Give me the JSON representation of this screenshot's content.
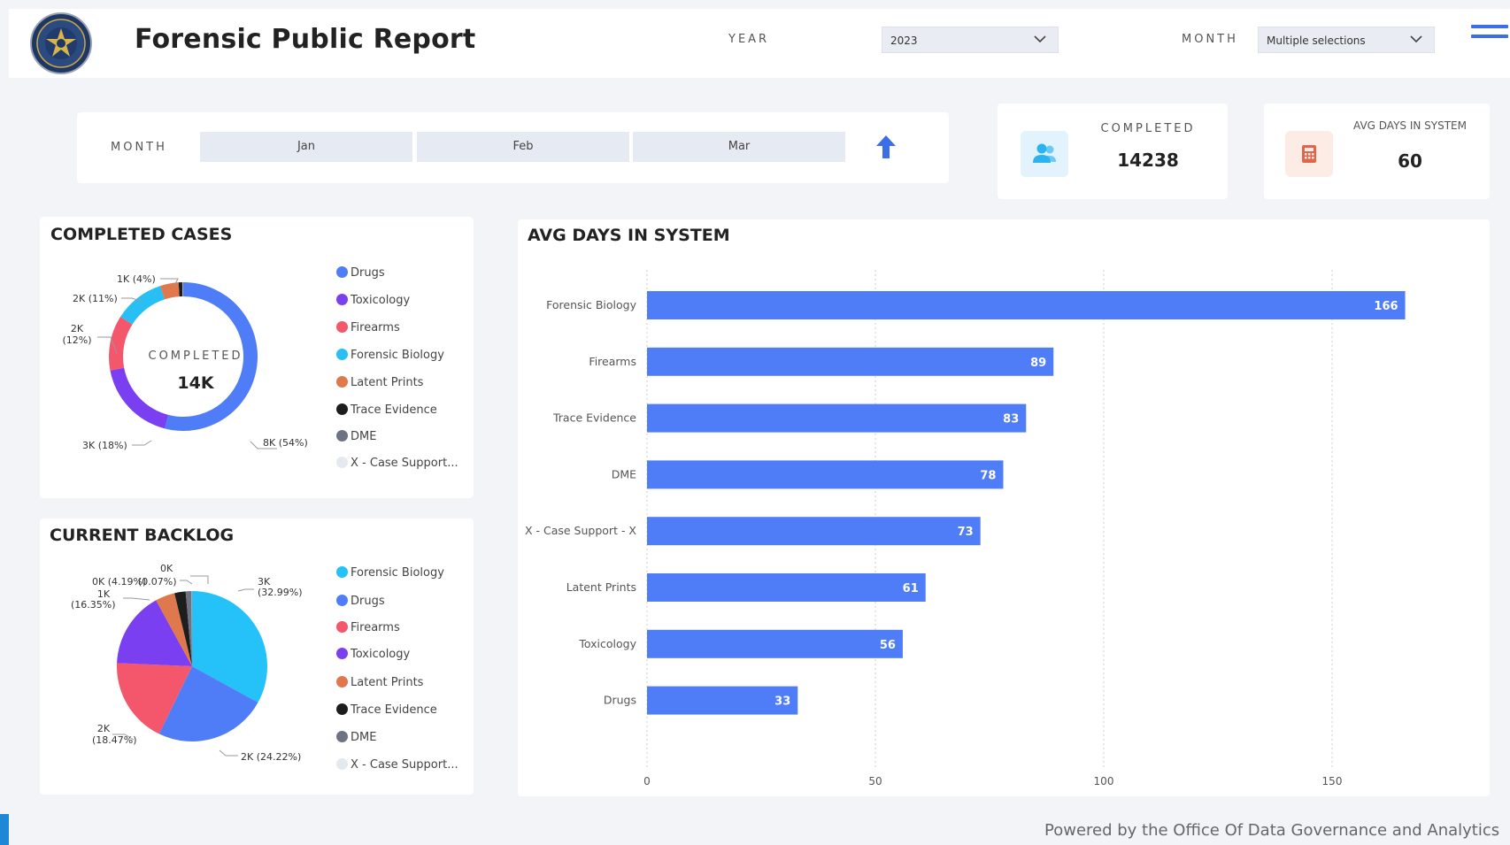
{
  "header": {
    "title": "Forensic Public Report",
    "year_label": "YEAR",
    "year_value": "2023",
    "month_label": "MONTH",
    "month_value": "Multiple selections"
  },
  "month_slicer": {
    "label": "MONTH",
    "months": [
      "Jan",
      "Feb",
      "Mar"
    ]
  },
  "kpis": {
    "completed": {
      "label": "COMPLETED",
      "value": "14238"
    },
    "avg_days": {
      "label": "AVG DAYS IN SYSTEM",
      "value": "60"
    }
  },
  "completed_cases": {
    "title": "COMPLETED CASES",
    "center_label": "COMPLETED",
    "center_value": "14K",
    "legend": [
      "Drugs",
      "Toxicology",
      "Firearms",
      "Forensic Biology",
      "Latent Prints",
      "Trace Evidence",
      "DME",
      "X - Case Support..."
    ],
    "labels": [
      "8K (54%)",
      "3K (18%)",
      "2K",
      "(12%)",
      "2K (11%)",
      "1K (4%)"
    ]
  },
  "current_backlog": {
    "title": "CURRENT BACKLOG",
    "legend": [
      "Forensic Biology",
      "Drugs",
      "Firearms",
      "Toxicology",
      "Latent Prints",
      "Trace Evidence",
      "DME",
      "X - Case Support..."
    ],
    "labels": [
      "3K",
      "(32.99%)",
      "2K (24.22%)",
      "2K",
      "(18.47%)",
      "1K",
      "(16.35%)",
      "0K (4.19%)",
      "(0.07%)",
      "0K"
    ]
  },
  "avg_days_chart": {
    "title": "AVG DAYS IN SYSTEM"
  },
  "chart_data": [
    {
      "type": "pie",
      "title": "COMPLETED CASES",
      "donut": true,
      "categories": [
        "Drugs",
        "Toxicology",
        "Firearms",
        "Forensic Biology",
        "Latent Prints",
        "Trace Evidence",
        "DME",
        "X - Case Support..."
      ],
      "values": [
        54,
        18,
        12,
        11,
        4,
        0.8,
        0.1,
        0.1
      ],
      "value_labels": [
        "8K (54%)",
        "3K (18%)",
        "2K (12%)",
        "2K (11%)",
        "1K (4%)"
      ],
      "colors": [
        "#4f7df8",
        "#7a3ff0",
        "#f4566b",
        "#28bff5",
        "#e0784e",
        "#1d1d1d",
        "#6e7383",
        "#e4e8ef"
      ]
    },
    {
      "type": "pie",
      "title": "CURRENT BACKLOG",
      "categories": [
        "Forensic Biology",
        "Drugs",
        "Firearms",
        "Toxicology",
        "Latent Prints",
        "Trace Evidence",
        "DME",
        "X - Case Support..."
      ],
      "values": [
        32.99,
        24.22,
        18.47,
        16.35,
        4.19,
        2.4,
        1.3,
        0.07
      ],
      "value_labels": [
        "3K (32.99%)",
        "2K (24.22%)",
        "2K (18.47%)",
        "1K (16.35%)",
        "0K (4.19%)",
        "0K (0.07%)"
      ],
      "colors": [
        "#24c2f8",
        "#4f7df8",
        "#f4566b",
        "#7a3ff0",
        "#e0784e",
        "#1d1d1d",
        "#6e7383",
        "#e4e8ef"
      ]
    },
    {
      "type": "bar",
      "orientation": "horizontal",
      "title": "AVG DAYS IN SYSTEM",
      "categories": [
        "Forensic Biology",
        "Firearms",
        "Trace Evidence",
        "DME",
        "X - Case Support - X",
        "Latent Prints",
        "Toxicology",
        "Drugs"
      ],
      "values": [
        166,
        89,
        83,
        78,
        73,
        61,
        56,
        33
      ],
      "xlim": [
        0,
        175
      ],
      "xticks": [
        0,
        50,
        100,
        150
      ],
      "grid": true,
      "bar_color": "#4f7df8"
    }
  ],
  "footer": {
    "text": "Powered by the Office Of Data Governance and Analytics"
  },
  "colors": {
    "accent": "#3b6fe8",
    "background": "#f3f4f8"
  }
}
